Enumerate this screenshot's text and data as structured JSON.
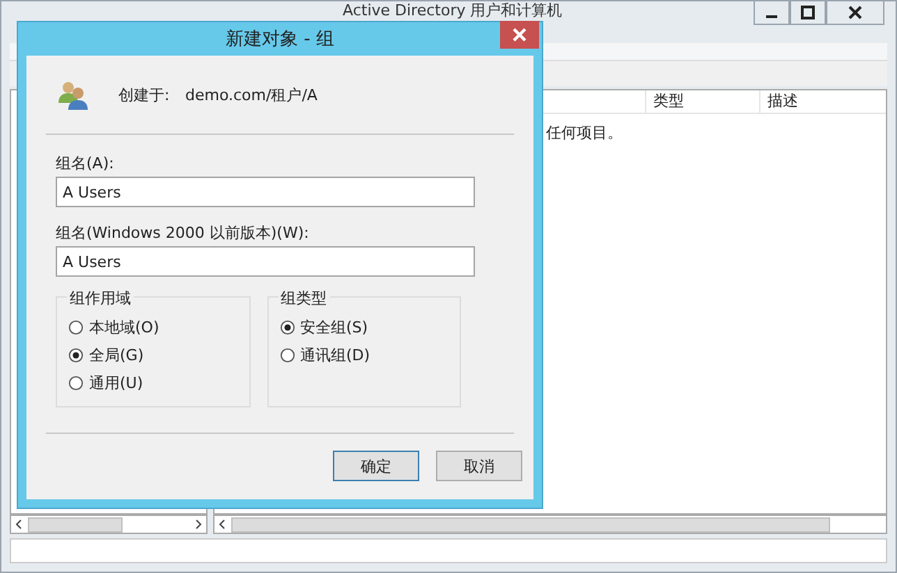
{
  "main_window": {
    "title": "Active Directory 用户和计算机",
    "list": {
      "columns": [
        "类型",
        "描述"
      ],
      "empty_message": "任何项目。"
    }
  },
  "dialog": {
    "title": "新建对象 - 组",
    "created_in_label": "创建于:",
    "created_in_value": "demo.com/租户/A",
    "fields": [
      {
        "label": "组名(A):",
        "value": "A Users"
      },
      {
        "label": "组名(Windows 2000 以前版本)(W):",
        "value": "A Users"
      }
    ],
    "groups": [
      {
        "title": "组作用域",
        "options": [
          {
            "label": "本地域(O)",
            "selected": false
          },
          {
            "label": "全局(G)",
            "selected": true
          },
          {
            "label": "通用(U)",
            "selected": false
          }
        ]
      },
      {
        "title": "组类型",
        "options": [
          {
            "label": "安全组(S)",
            "selected": true
          },
          {
            "label": "通讯组(D)",
            "selected": false
          }
        ]
      }
    ],
    "buttons": [
      {
        "label": "确定",
        "default": true
      },
      {
        "label": "取消",
        "default": false
      }
    ]
  }
}
